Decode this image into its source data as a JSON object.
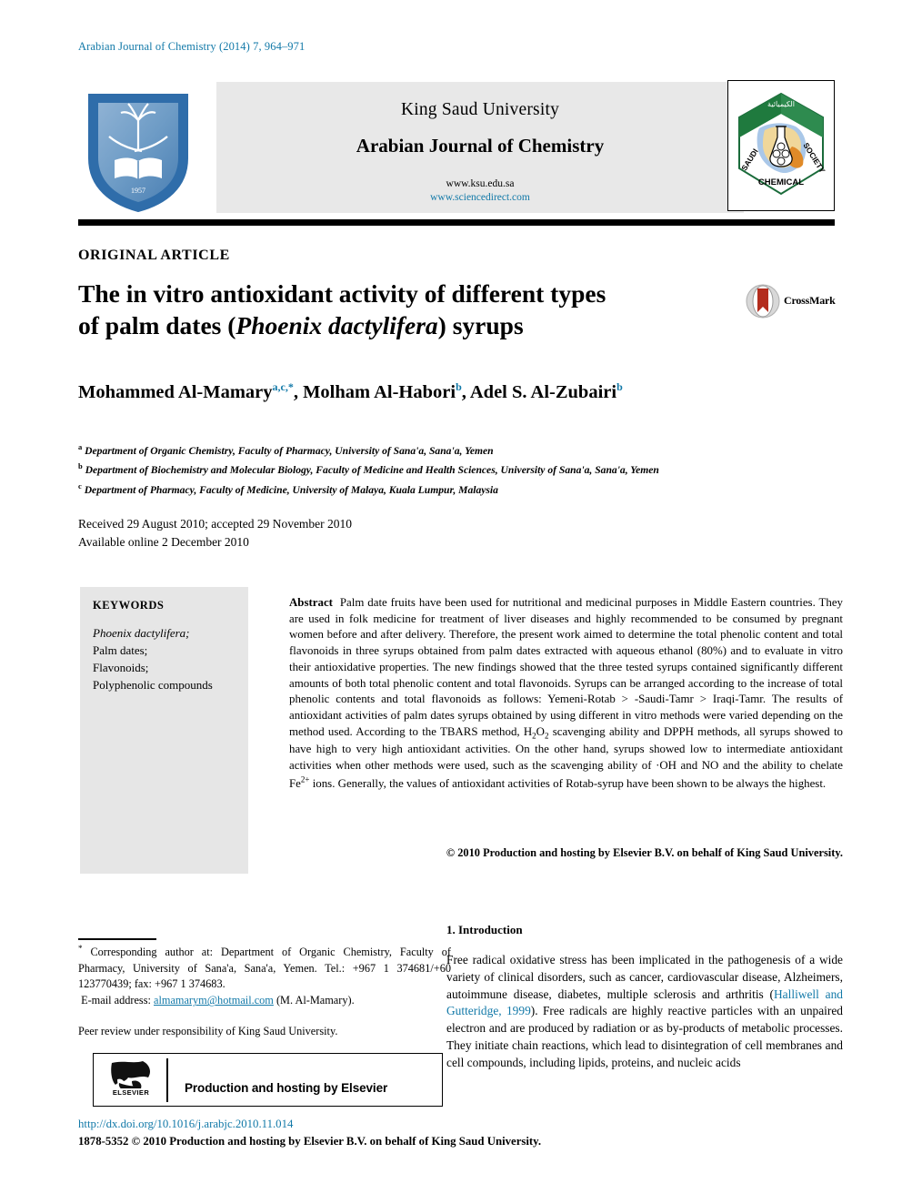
{
  "running_head": "Arabian Journal of Chemistry (2014) 7, 964–971",
  "masthead": {
    "university": "King Saud University",
    "journal": "Arabian Journal of Chemistry",
    "url_ksu": "www.ksu.edu.sa",
    "url_sciencedirect": "www.sciencedirect.com",
    "ksu_logo_alt": "King Saud University",
    "scs_logo_alt": "Saudi Chemical Society",
    "scs_logo_text_left": "SAUDI",
    "scs_logo_text_right": "SOCIETY",
    "scs_logo_text_bottom": "CHEMICAL"
  },
  "article": {
    "type": "ORIGINAL ARTICLE",
    "title_line1": "The in vitro antioxidant activity of different types",
    "title_line2_pre": "of palm dates (",
    "title_italic": "Phoenix dactylifera",
    "title_line2_post": ") syrups",
    "crossmark_label": "CrossMark",
    "authors": [
      {
        "name": "Mohammed Al-Mamary",
        "sup": "a,c,*"
      },
      {
        "name": "Molham Al-Habori",
        "sup": "b"
      },
      {
        "name": "Adel S. Al-Zubairi",
        "sup": "b"
      }
    ],
    "affiliations": [
      {
        "marker": "a",
        "text": "Department of Organic Chemistry, Faculty of Pharmacy, University of Sana'a, Sana'a, Yemen"
      },
      {
        "marker": "b",
        "text": "Department of Biochemistry and Molecular Biology, Faculty of Medicine and Health Sciences, University of Sana'a, Sana'a, Yemen"
      },
      {
        "marker": "c",
        "text": "Department of Pharmacy, Faculty of Medicine, University of Malaya, Kuala Lumpur, Malaysia"
      }
    ],
    "received_line": "Received 29 August 2010; accepted 29 November 2010",
    "available_line": "Available online 2 December 2010"
  },
  "keywords": {
    "heading": "KEYWORDS",
    "items": [
      "Phoenix dactylifera;",
      "Palm dates;",
      "Flavonoids;",
      "Polyphenolic compounds"
    ]
  },
  "abstract": {
    "label": "Abstract",
    "text": "Palm date fruits have been used for nutritional and medicinal purposes in Middle Eastern countries. They are used in folk medicine for treatment of liver diseases and highly recommended to be consumed by pregnant women before and after delivery. Therefore, the present work aimed to determine the total phenolic content and total flavonoids in three syrups obtained from palm dates extracted with aqueous ethanol (80%) and to evaluate in vitro their antioxidative properties. The new findings showed that the three tested syrups contained significantly different amounts of both total phenolic content and total flavonoids. Syrups can be arranged according to the increase of total phenolic contents and total flavonoids as follows: Yemeni-Rotab > -Saudi-Tamr > Iraqi-Tamr. The results of antioxidant activities of palm dates syrups obtained by using different in vitro methods were varied depending on the method used. According to the TBARS method, H2O2 scavenging ability and DPPH methods, all syrups showed to have high to very high antioxidant activities. On the other hand, syrups showed low to intermediate antioxidant activities when other methods were used, such as the scavenging ability of ·OH and NO and the ability to chelate Fe2+ ions. Generally, the values of antioxidant activities of Rotab-syrup have been shown to be always the highest.",
    "copyright": "© 2010 Production and hosting by Elsevier B.V. on behalf of King Saud University."
  },
  "footnote": {
    "corresponding": "Corresponding author at: Department of Organic Chemistry, Faculty of Pharmacy, University of Sana'a, Sana'a, Yemen. Tel.: +967 1 374681/+60 123770439; fax: +967 1 374683.",
    "email_label": "E-mail address:",
    "email": "almamarym@hotmail.com",
    "email_owner": "(M. Al-Mamary).",
    "peer_review": "Peer review under responsibility of King Saud University.",
    "elsevier_banner": "Production and hosting by Elsevier",
    "elsevier_wordmark": "ELSEVIER"
  },
  "footer": {
    "doi": "http://dx.doi.org/10.1016/j.arabjc.2010.11.014",
    "issn_line": "1878-5352 © 2010 Production and hosting by Elsevier B.V. on behalf of King Saud University."
  },
  "introduction": {
    "heading": "1. Introduction",
    "paragraph_part1": "Free radical oxidative stress has been implicated in the pathogenesis of a wide variety of clinical disorders, such as cancer, cardiovascular disease, Alzheimers, autoimmune disease, diabetes, multiple sclerosis and arthritis (",
    "citation": "Halliwell and Gutteridge, 1999",
    "paragraph_part2": "). Free radicals are highly reactive particles with an unpaired electron and are produced by radiation or as by-products of metabolic processes. They initiate chain reactions, which lead to disintegration of cell membranes and cell compounds, including lipids, proteins, and nucleic acids"
  },
  "colors": {
    "link": "#1279a8",
    "band": "#e8e8e8",
    "keyword_box": "#e6e6e6"
  }
}
